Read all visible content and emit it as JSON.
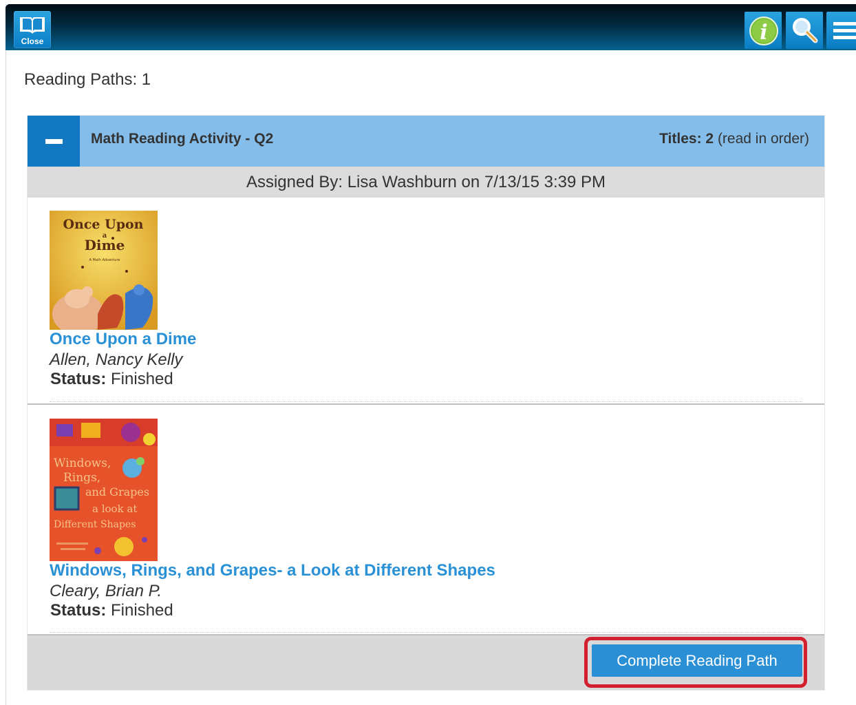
{
  "toolbar": {
    "close_label": "Close",
    "icons": [
      "book-close-icon",
      "info-icon",
      "search-icon",
      "menu-icon"
    ]
  },
  "reading_paths": {
    "count_label": "Reading Paths: 1"
  },
  "path": {
    "title": "Math Reading Activity - Q2",
    "titles_label": "Titles: 2",
    "order_note": "(read in order)",
    "assigned": "Assigned By: Lisa Washburn on 7/13/15 3:39 PM",
    "books": [
      {
        "title": "Once Upon a Dime",
        "author": "Allen, Nancy Kelly",
        "status_label": "Status:",
        "status": "Finished",
        "cover": {
          "line1": "Once Upon",
          "line2": "a",
          "line3": "Dime",
          "subtitle": "A Math Adventure"
        }
      },
      {
        "title": "Windows, Rings, and Grapes- a Look at Different Shapes",
        "author": "Cleary, Brian P.",
        "status_label": "Status:",
        "status": "Finished",
        "cover": {
          "line1": "Windows,",
          "line2": "Rings,",
          "line3": "and Grapes",
          "line4": "a look at",
          "line5": "Different Shapes"
        }
      }
    ],
    "complete_button": "Complete Reading Path"
  },
  "colors": {
    "accent": "#2b8fd6",
    "header_bar": "#84bde9",
    "highlight": "#d3202e"
  }
}
